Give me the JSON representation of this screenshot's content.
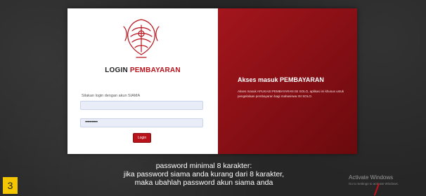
{
  "login_card": {
    "title_part1": "LOGIN",
    "title_part2": "PEMBAYARAN",
    "hint": "Silakan login dengan akun SIAMA",
    "username_value": "",
    "password_value": "•••••••••••",
    "login_button": "Login"
  },
  "access_panel": {
    "title": "Akses masuk PEMBAYARAN",
    "description": "Akses masuk APLIKASI PEMBAYARAN ISI SOLO, aplikasi ini khusus untuk pengelolaan pembayaran bagi mahasiswa ISI SOLO."
  },
  "caption": {
    "line1": "password minimal 8 karakter:",
    "line2": "jika password siama anda kurang dari 8 karakter,",
    "line3": "maka ubahlah password akun siama anda"
  },
  "slide_number": "3",
  "activate_windows": {
    "title": "Activate Windows",
    "subtitle": "Go to Settings to activate Windows."
  },
  "colors": {
    "brand_red": "#b8121b",
    "panel_red_dark": "#6a0a0e",
    "badge_yellow": "#f4c600"
  }
}
